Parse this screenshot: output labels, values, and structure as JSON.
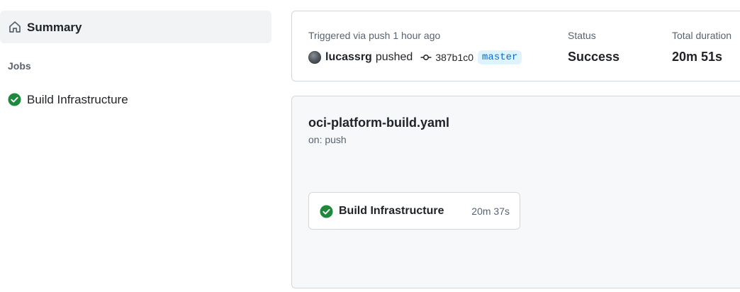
{
  "sidebar": {
    "summary_label": "Summary",
    "jobs_heading": "Jobs",
    "jobs": [
      {
        "label": "Build Infrastructure",
        "status": "success"
      }
    ]
  },
  "run_summary": {
    "trigger_text": "Triggered via push 1 hour ago",
    "actor": "lucassrg",
    "action": "pushed",
    "commit_sha": "387b1c0",
    "branch": "master",
    "status_label": "Status",
    "status_value": "Success",
    "duration_label": "Total duration",
    "duration_value": "20m 51s"
  },
  "workflow": {
    "file_name": "oci-platform-build.yaml",
    "trigger": "on: push",
    "job": {
      "name": "Build Infrastructure",
      "duration": "20m 37s",
      "status": "success"
    }
  },
  "colors": {
    "success": "#1f883d",
    "accent": "#0969da",
    "branch_bg": "#ddf4ff",
    "muted_text": "#59636e"
  },
  "icons": {
    "summary": "home-icon",
    "job_status": "check-circle-icon",
    "commit": "git-commit-icon"
  }
}
